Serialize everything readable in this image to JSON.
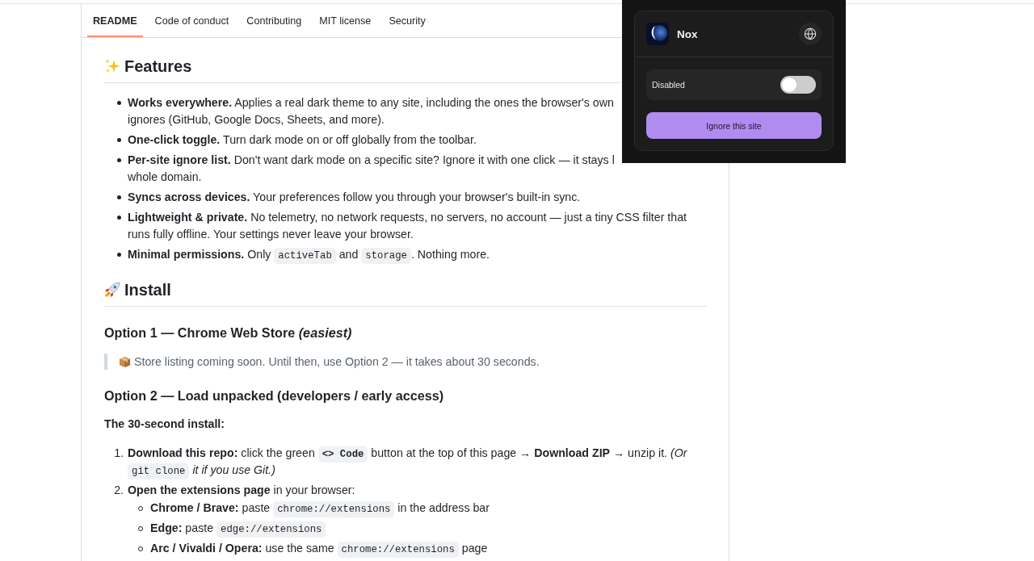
{
  "tabs": [
    {
      "label": "README",
      "selected": true
    },
    {
      "label": "Code of conduct",
      "selected": false
    },
    {
      "label": "Contributing",
      "selected": false
    },
    {
      "label": "MIT license",
      "selected": false
    },
    {
      "label": "Security",
      "selected": false
    }
  ],
  "features": {
    "title": "Features",
    "items": [
      {
        "lines": [
          [
            {
              "kind": "text",
              "text": "**Works everywhere.** Applies a real dark theme to any site, including the ones the browser's own"
            }
          ],
          [
            {
              "kind": "text",
              "text": "ignores (GitHub, Google Docs, Sheets, and more)."
            }
          ]
        ]
      },
      {
        "lines": [
          [
            {
              "kind": "text",
              "text": "**One-click toggle.** Turn dark mode on or off globally from the toolbar."
            }
          ]
        ]
      },
      {
        "lines": [
          [
            {
              "kind": "text",
              "text": "**Per-site ignore list.** Don't want dark mode on a specific site? Ignore it with one click — it stays l"
            }
          ],
          [
            {
              "kind": "text",
              "text": "whole domain."
            }
          ]
        ]
      },
      {
        "lines": [
          [
            {
              "kind": "text",
              "text": "**Syncs across devices.** Your preferences follow you through your browser's built-in sync."
            }
          ]
        ]
      },
      {
        "lines": [
          [
            {
              "kind": "text",
              "text": "**Lightweight & private.** No telemetry, no network requests, no servers, no account — just a tiny CSS filter that"
            }
          ],
          [
            {
              "kind": "text",
              "text": "runs fully offline. Your settings never leave your browser."
            }
          ]
        ]
      },
      {
        "lines": [
          [
            {
              "kind": "text",
              "text": "**Minimal permissions.** Only "
            },
            {
              "kind": "code",
              "text": "activeTab"
            },
            {
              "kind": "text",
              "text": " and "
            },
            {
              "kind": "code",
              "text": "storage"
            },
            {
              "kind": "text",
              "text": ". Nothing more."
            }
          ]
        ]
      }
    ]
  },
  "install": {
    "title": "Install",
    "option_1": {
      "title": "Option 1 — Chrome Web Store *(easiest)*",
      "note": "Store listing coming soon. Until then, use Option 2 — it takes about 30 seconds."
    },
    "option_2": {
      "title": "Option 2 — Load unpacked (developers / early access)",
      "intro": "The 30-second install:",
      "steps": [
        {
          "number": "1.",
          "lines": [
            [
              {
                "kind": "text",
                "text": "**Download this repo:** click the green "
              },
              {
                "kind": "bold_code",
                "text": "<> Code"
              },
              {
                "kind": "text",
                "text": " button at the top of this page → **Download ZIP** → unzip it. *(Or*"
              }
            ],
            [
              {
                "kind": "code",
                "text": "git clone"
              },
              {
                "kind": "text",
                "text": " *it if you use Git.)*"
              }
            ]
          ]
        },
        {
          "number": "2.",
          "lines": [
            [
              {
                "kind": "text",
                "text": "**Open the extensions page** in your browser:"
              }
            ]
          ],
          "children": [
            {
              "lines": [
                [
                  {
                    "kind": "text",
                    "text": "**Chrome / Brave:** paste "
                  },
                  {
                    "kind": "code",
                    "text": "chrome://extensions"
                  },
                  {
                    "kind": "text",
                    "text": " in the address bar"
                  }
                ]
              ]
            },
            {
              "lines": [
                [
                  {
                    "kind": "text",
                    "text": "**Edge:** paste "
                  },
                  {
                    "kind": "code",
                    "text": "edge://extensions"
                  }
                ]
              ]
            },
            {
              "lines": [
                [
                  {
                    "kind": "text",
                    "text": "**Arc / Vivaldi / Opera:** use the same "
                  },
                  {
                    "kind": "code",
                    "text": "chrome://extensions"
                  },
                  {
                    "kind": "text",
                    "text": " page"
                  }
                ]
              ]
            }
          ]
        }
      ]
    }
  },
  "popup": {
    "app_name": "Nox",
    "toggle": {
      "label": "Disabled",
      "on": false
    },
    "button": "Ignore this site"
  }
}
